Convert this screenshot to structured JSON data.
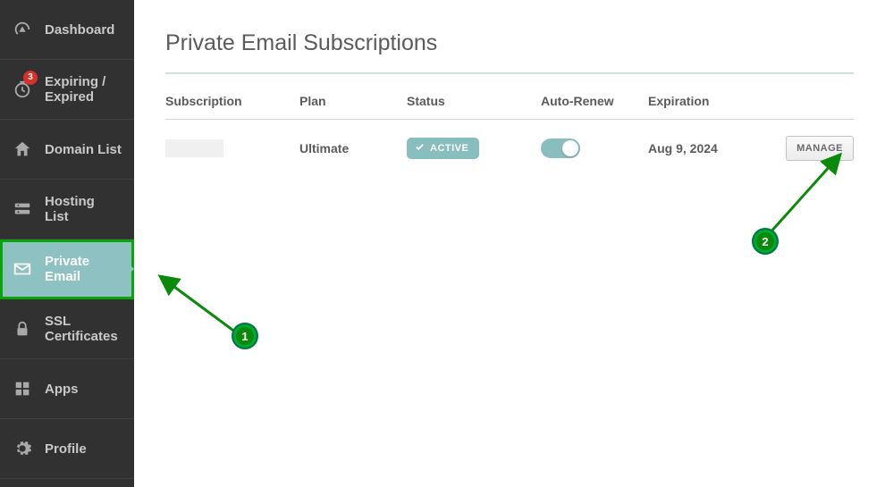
{
  "sidebar": {
    "items": [
      {
        "label": "Dashboard"
      },
      {
        "label": "Expiring / Expired",
        "badge": "3"
      },
      {
        "label": "Domain List"
      },
      {
        "label": "Hosting List"
      },
      {
        "label": "Private Email"
      },
      {
        "label": "SSL Certificates"
      },
      {
        "label": "Apps"
      },
      {
        "label": "Profile"
      }
    ]
  },
  "page": {
    "title": "Private Email Subscriptions"
  },
  "table": {
    "headers": {
      "subscription": "Subscription",
      "plan": "Plan",
      "status": "Status",
      "autorenew": "Auto-Renew",
      "expiration": "Expiration"
    },
    "row": {
      "plan": "Ultimate",
      "status_label": "ACTIVE",
      "expiration": "Aug 9, 2024",
      "manage_label": "MANAGE"
    }
  },
  "annotations": {
    "one": "1",
    "two": "2"
  }
}
